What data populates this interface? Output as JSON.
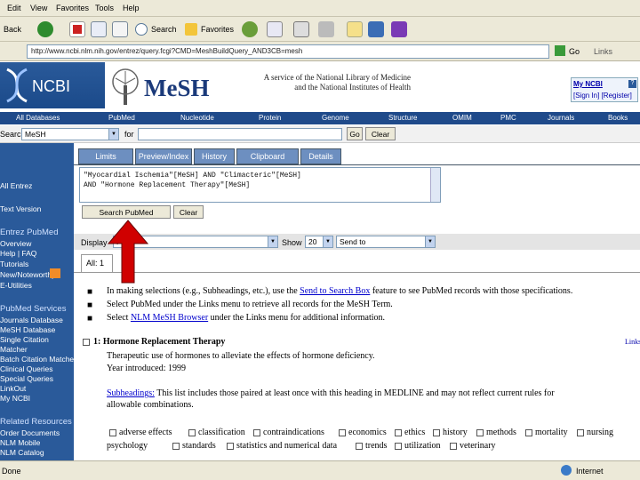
{
  "menu": [
    "Edit",
    "View",
    "Favorites",
    "Tools",
    "Help"
  ],
  "toolbar": {
    "back": "Back",
    "search": "Search",
    "favorites": "Favorites",
    "go": "Go",
    "links": "Links"
  },
  "address": "http://www.ncbi.nlm.nih.gov/entrez/query.fcgi?CMD=MeshBuildQuery_AND3CB=mesh",
  "header": {
    "ncbi": "NCBI",
    "mesh": "MeSH",
    "tagline_1": "A service of the National Library of Medicine",
    "tagline_2": "and the National Institutes of Health",
    "my_ncbi": "My NCBI",
    "sign": "[Sign In] [Register]"
  },
  "nav": [
    "All Databases",
    "PubMed",
    "Nucleotide",
    "Protein",
    "Genome",
    "Structure",
    "OMIM",
    "PMC",
    "Journals",
    "Books"
  ],
  "search": {
    "label": "Search",
    "db": "MeSH",
    "for": "for",
    "go": "Go",
    "clear": "Clear"
  },
  "tabs": [
    "Limits",
    "Preview/Index",
    "History",
    "Clipboard",
    "Details"
  ],
  "query": {
    "line1": "\"Myocardial Ischemia\"[MeSH] AND \"Climacteric\"[MeSH]",
    "line2": "AND \"Hormone Replacement Therapy\"[MeSH]",
    "search_pubmed": "Search PubMed",
    "clear": "Clear"
  },
  "display": {
    "label": "Display",
    "format": "Full",
    "show_label": "Show",
    "show": "20",
    "send_to": "Send to"
  },
  "all_tab": "All: 1",
  "bullets": [
    {
      "pre": "In making selections (e.g., Subheadings, etc.), use the ",
      "link": "Send to Search Box",
      "post": " feature to see PubMed records with those specifications."
    },
    {
      "pre": "Select PubMed under the Links menu to retrieve all records for the MeSH Term.",
      "link": "",
      "post": ""
    },
    {
      "pre": "Select ",
      "link": "NLM MeSH Browser",
      "post": " under the Links menu for additional information."
    }
  ],
  "result": {
    "num": "1:",
    "title": "Hormone Replacement Therapy",
    "links": "Links",
    "desc": "Therapeutic use of hormones to alleviate the effects of hormone deficiency.",
    "year": "Year introduced: 1999",
    "subh_link": "Subheadings:",
    "subh_text": " This list includes those paired at least once with this heading in MEDLINE and may not reflect current rules for",
    "subh_text2": "allowable combinations."
  },
  "subheadings_row1": [
    "adverse effects",
    "classification",
    "contraindications",
    "economics",
    "ethics",
    "history",
    "methods",
    "mortality",
    "nursing"
  ],
  "subheadings_row2": [
    "psychology",
    "standards",
    "statistics and numerical data",
    "trends",
    "utilization",
    "veterinary"
  ],
  "sidebar": {
    "entrez": "All Entrez",
    "text": "Text Version",
    "entrez_pubmed": "Entrez PubMed",
    "pubmed_links": [
      "Overview",
      "Help | FAQ",
      "Tutorials",
      "New/Noteworthy",
      "E-Utilities"
    ],
    "pubmed_services": "PubMed Services",
    "services": [
      "Journals Database",
      "MeSH Database",
      "Single Citation",
      "Matcher",
      "Batch Citation Matcher",
      "Clinical Queries",
      "Special Queries",
      "LinkOut",
      "My NCBI"
    ],
    "related": "Related Resources",
    "related_links": [
      "Order Documents",
      "NLM Mobile",
      "NLM Catalog"
    ]
  },
  "status": {
    "left": "Done",
    "zone": "Internet"
  }
}
